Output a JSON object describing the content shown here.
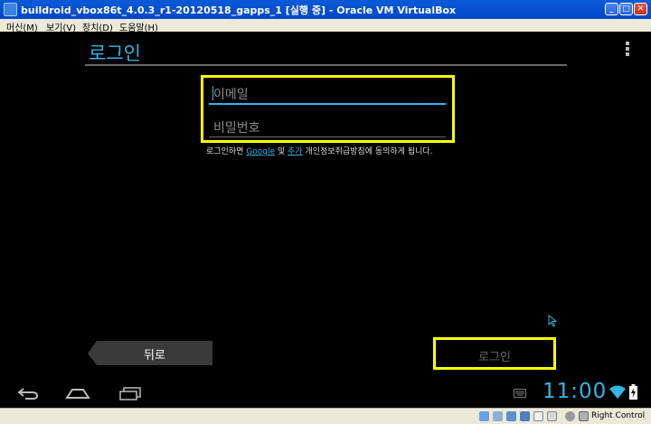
{
  "window": {
    "title": "buildroid_vbox86t_4.0.3_r1-20120518_gapps_1 [실행 중] - Oracle VM VirtualBox"
  },
  "menu": [
    {
      "label": "머신(M)"
    },
    {
      "label": "보기(V)"
    },
    {
      "label": "장치(D)"
    },
    {
      "label": "도움말(H)"
    }
  ],
  "screen": {
    "title": "로그인",
    "email_placeholder": "이메일",
    "password_placeholder": "비밀번호",
    "terms": {
      "before": "로그인하면 ",
      "link1": "Google",
      "middle": " 및 ",
      "link2": "추가",
      "after": " 개인정보취급방침에 동의하게 됩니다."
    },
    "back_label": "뒤로",
    "login_label": "로그인"
  },
  "navbar": {
    "clock": "11:00"
  },
  "statusbar": {
    "host_key": "Right Control"
  },
  "colors": {
    "accent": "#33b5e5",
    "highlight": "#ffff00",
    "titlebar": "#0a5ad8"
  }
}
